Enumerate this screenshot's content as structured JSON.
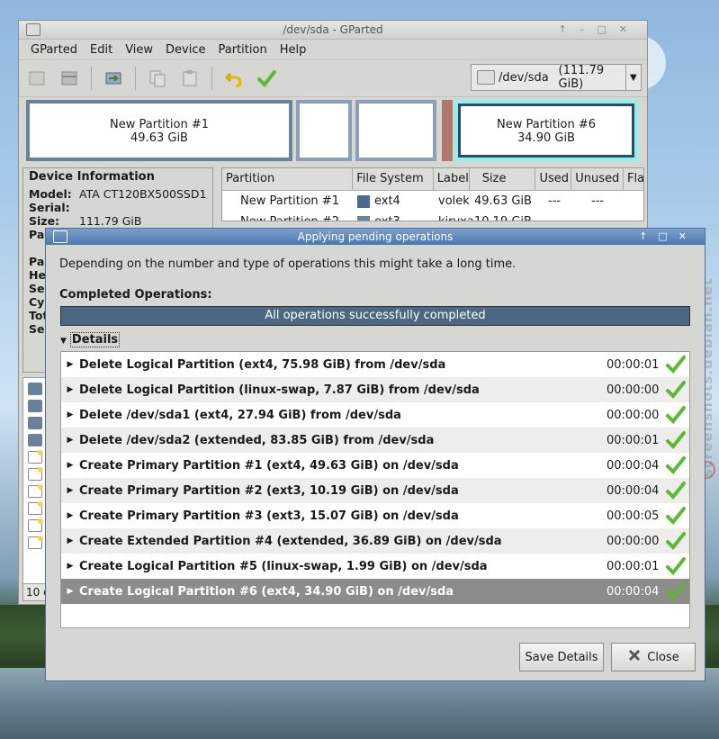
{
  "gparted": {
    "title": "/dev/sda - GParted",
    "menu": [
      "GParted",
      "Edit",
      "View",
      "Device",
      "Partition",
      "Help"
    ],
    "toolbar_icons": [
      "new-partition-icon",
      "delete-partition-icon",
      "resize-move-icon",
      "copy-icon",
      "paste-icon",
      "undo-icon",
      "apply-icon"
    ],
    "device_combo": {
      "device": "/dev/sda",
      "size": "(111.79 GiB)"
    },
    "map": [
      {
        "name": "New Partition #1",
        "size": "49.63 GiB"
      },
      {
        "name": "",
        "size": ""
      },
      {
        "name": "",
        "size": ""
      },
      {
        "name": "New Partition #6",
        "size": "34.90 GiB"
      }
    ],
    "device_info": {
      "heading": "Device Information",
      "rows": [
        {
          "label": "Model:",
          "value": "ATA CT120BX500SSD1"
        },
        {
          "label": "Serial:",
          "value": ""
        },
        {
          "label": "Size:",
          "value": "111.79 GiB"
        },
        {
          "label": "Pa",
          "value": ""
        },
        {
          "label": "",
          "value": ""
        },
        {
          "label": "Pa",
          "value": ""
        },
        {
          "label": "He",
          "value": ""
        },
        {
          "label": "Se",
          "value": ""
        },
        {
          "label": "Cy",
          "value": ""
        },
        {
          "label": "Tot",
          "value": ""
        },
        {
          "label": "Se",
          "value": ""
        }
      ]
    },
    "table": {
      "headers": [
        "Partition",
        "File System",
        "Label",
        "Size",
        "Used",
        "Unused",
        "Fla"
      ],
      "rows": [
        {
          "partition": "New Partition #1",
          "fs": "ext4",
          "label": "volek",
          "size": "49.63 GiB",
          "used": "---",
          "unused": "---"
        },
        {
          "partition": "New Partition #2",
          "fs": "ext3",
          "label": "kiryxa",
          "size": "10.19 GiB",
          "used": "---",
          "unused": "---"
        }
      ]
    },
    "status_text": "10 o"
  },
  "dialog": {
    "title": "Applying pending operations",
    "message": "Depending on the number and type of operations this might take a long time.",
    "completed_label": "Completed Operations:",
    "progress_text": "All operations successfully completed",
    "progress": 1.0,
    "details_label": "Details",
    "operations": [
      {
        "text": "Delete Logical Partition (ext4, 75.98 GiB) from /dev/sda",
        "time": "00:00:01"
      },
      {
        "text": "Delete Logical Partition (linux-swap, 7.87 GiB) from /dev/sda",
        "time": "00:00:00"
      },
      {
        "text": "Delete /dev/sda1 (ext4, 27.94 GiB) from /dev/sda",
        "time": "00:00:00"
      },
      {
        "text": "Delete /dev/sda2 (extended, 83.85 GiB) from /dev/sda",
        "time": "00:00:01"
      },
      {
        "text": "Create Primary Partition #1 (ext4, 49.63 GiB) on /dev/sda",
        "time": "00:00:04"
      },
      {
        "text": "Create Primary Partition #2 (ext3, 10.19 GiB) on /dev/sda",
        "time": "00:00:04"
      },
      {
        "text": "Create Primary Partition #3 (ext3, 15.07 GiB) on /dev/sda",
        "time": "00:00:05"
      },
      {
        "text": "Create Extended Partition #4 (extended, 36.89 GiB) on /dev/sda",
        "time": "00:00:00"
      },
      {
        "text": "Create Logical Partition #5 (linux-swap, 1.99 GiB) on /dev/sda",
        "time": "00:00:01"
      },
      {
        "text": "Create Logical Partition #6 (ext4, 34.90 GiB) on /dev/sda",
        "time": "00:00:04"
      }
    ],
    "save_button": "Save Details",
    "close_button": "Close"
  },
  "watermark": "screenshots.debian.net",
  "colors": {
    "accent": "#4b76ae",
    "progress": "#4c6781",
    "check": "#5db832",
    "ext4": "#4b6a91"
  }
}
